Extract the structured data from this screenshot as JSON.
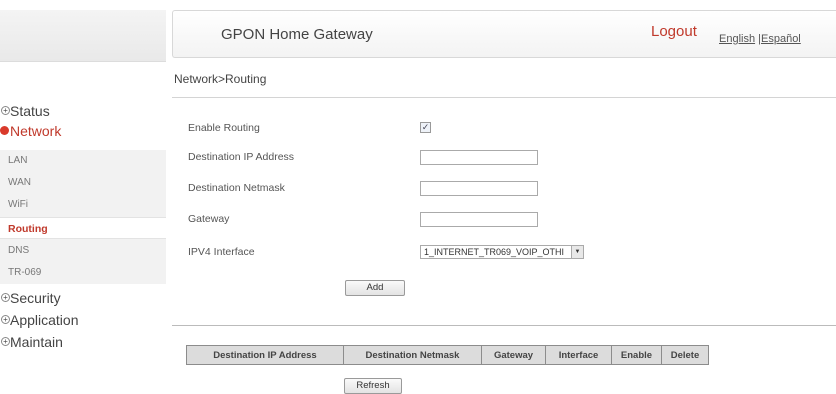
{
  "header": {
    "title": "GPON Home Gateway",
    "logout": "Logout",
    "lang_english": "English",
    "lang_separator": "|",
    "lang_espanol": "Español"
  },
  "breadcrumb": "Network>Routing",
  "sidebar": {
    "status": "Status",
    "network": "Network",
    "network_items": [
      "LAN",
      "WAN",
      "WiFi",
      "Routing",
      "DNS",
      "TR-069"
    ],
    "selected": "Routing",
    "security": "Security",
    "application": "Application",
    "maintain": "Maintain"
  },
  "form": {
    "enable_routing_label": "Enable Routing",
    "enable_routing_checked": true,
    "dest_ip_label": "Destination IP Address",
    "dest_ip_value": "",
    "dest_netmask_label": "Destination Netmask",
    "dest_netmask_value": "",
    "gateway_label": "Gateway",
    "gateway_value": "",
    "ipv4_interface_label": "IPV4 Interface",
    "ipv4_interface_value": "1_INTERNET_TR069_VOIP_OTHI",
    "add_button": "Add"
  },
  "table": {
    "columns": [
      "Destination IP Address",
      "Destination Netmask",
      "Gateway",
      "Interface",
      "Enable",
      "Delete"
    ],
    "rows": []
  },
  "refresh_button": "Refresh",
  "colors": {
    "accent": "#c0392b",
    "header_bg": "#f3f3f3",
    "table_header_bg": "#dcdcdc"
  }
}
